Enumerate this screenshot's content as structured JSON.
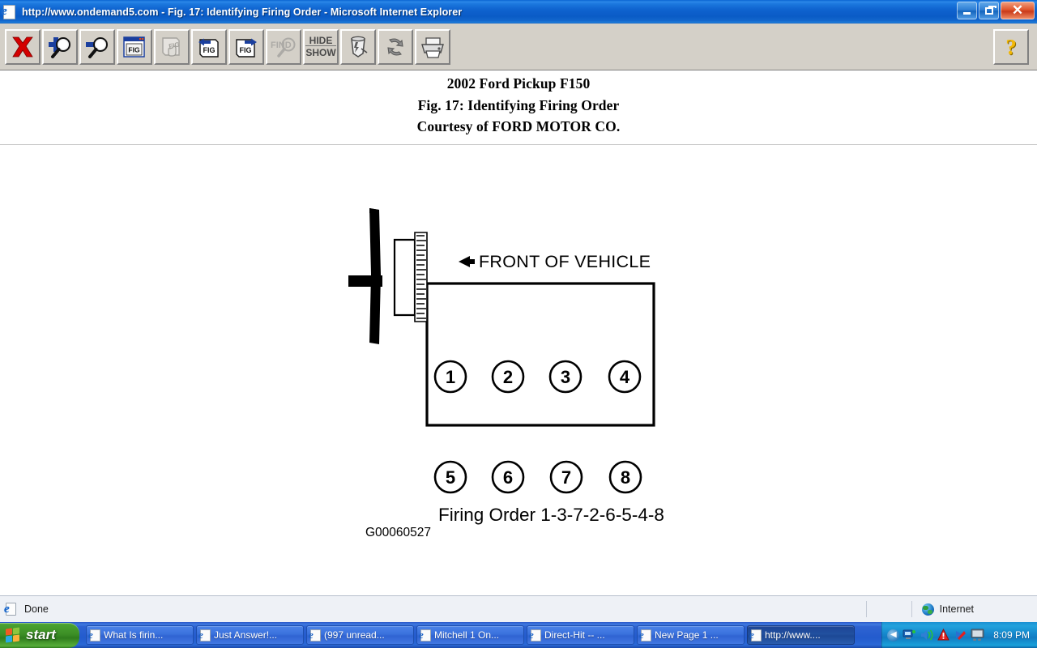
{
  "window": {
    "title": "http://www.ondemand5.com - Fig. 17: Identifying Firing Order - Microsoft Internet Explorer",
    "icon": "ie-document-icon",
    "minimize_label": "",
    "maximize_label": "",
    "close_label": "✕"
  },
  "toolbar": {
    "buttons": [
      {
        "name": "close-x-button",
        "label": "X",
        "icon": "red-x-icon",
        "enabled": true
      },
      {
        "name": "zoom-in-button",
        "label": "",
        "icon": "magnifier-plus-icon",
        "enabled": true
      },
      {
        "name": "zoom-out-button",
        "label": "",
        "icon": "magnifier-minus-icon",
        "enabled": true
      },
      {
        "name": "fig-window-button",
        "label": "FIG",
        "icon": "fig-window-icon",
        "enabled": true
      },
      {
        "name": "fig-drag-button",
        "label": "FIG",
        "icon": "fig-hand-icon",
        "enabled": false
      },
      {
        "name": "fig-previous-button",
        "label": "FIG",
        "icon": "fig-back-arrow-icon",
        "enabled": true
      },
      {
        "name": "fig-next-button",
        "label": "FIG",
        "icon": "fig-forward-arrow-icon",
        "enabled": true
      },
      {
        "name": "find-button",
        "label": "FIND",
        "icon": "find-magnifier-icon",
        "enabled": false
      },
      {
        "name": "hide-show-button",
        "label": "HIDE SHOW",
        "icon": "hide-show-icon",
        "enabled": true
      },
      {
        "name": "paint-bucket-button",
        "label": "",
        "icon": "paint-bucket-icon",
        "enabled": true
      },
      {
        "name": "refresh-button",
        "label": "",
        "icon": "refresh-arrows-icon",
        "enabled": true
      },
      {
        "name": "print-button",
        "label": "",
        "icon": "printer-icon",
        "enabled": true
      }
    ],
    "hide_show_line1": "HIDE",
    "hide_show_line2": "SHOW",
    "find_label": "FIND",
    "fig_label": "FIG",
    "close_label": "X",
    "help_label": "?"
  },
  "document": {
    "heading_line1": "2002 Ford Pickup F150",
    "heading_line2": "Fig. 17: Identifying Firing Order",
    "heading_line3": "Courtesy of FORD MOTOR CO.",
    "figure": {
      "front_of_vehicle_label": "FRONT OF VEHICLE",
      "front_arrow": "◀",
      "cylinders_top": [
        "1",
        "2",
        "3",
        "4"
      ],
      "cylinders_bottom": [
        "5",
        "6",
        "7",
        "8"
      ],
      "firing_order_label": "Firing Order 1-3-7-2-6-5-4-8",
      "part_number": "G00060527"
    }
  },
  "statusbar": {
    "status_text": "Done",
    "status_icon": "ie-document-icon",
    "zone_text": "Internet",
    "zone_icon": "globe-icon"
  },
  "taskbar": {
    "start_label": "start",
    "start_icon": "windows-flag-icon",
    "tasks": [
      {
        "label": "What Is firin...",
        "active": false
      },
      {
        "label": "Just Answer!...",
        "active": false
      },
      {
        "label": "(997 unread...",
        "active": false
      },
      {
        "label": "Mitchell 1 On...",
        "active": false
      },
      {
        "label": "Direct-Hit -- ...",
        "active": false
      },
      {
        "label": "New Page 1 ...",
        "active": false
      },
      {
        "label": "http://www....",
        "active": true
      }
    ],
    "tray": {
      "expand_icon": "chevron-left-icon",
      "icons": [
        "network-monitor-icon",
        "volume-icon",
        "antivirus-icon",
        "messenger-icon",
        "display-icon"
      ],
      "clock": "8:09 PM"
    }
  },
  "colors": {
    "titlebar_blue": "#0f63cf",
    "toolbar_gray": "#d4d0c8",
    "taskbar_blue": "#235bcd",
    "start_green": "#3c8f26",
    "close_red": "#c8391a",
    "help_yellow": "#f2b705",
    "status_bg": "#eef1f6"
  }
}
